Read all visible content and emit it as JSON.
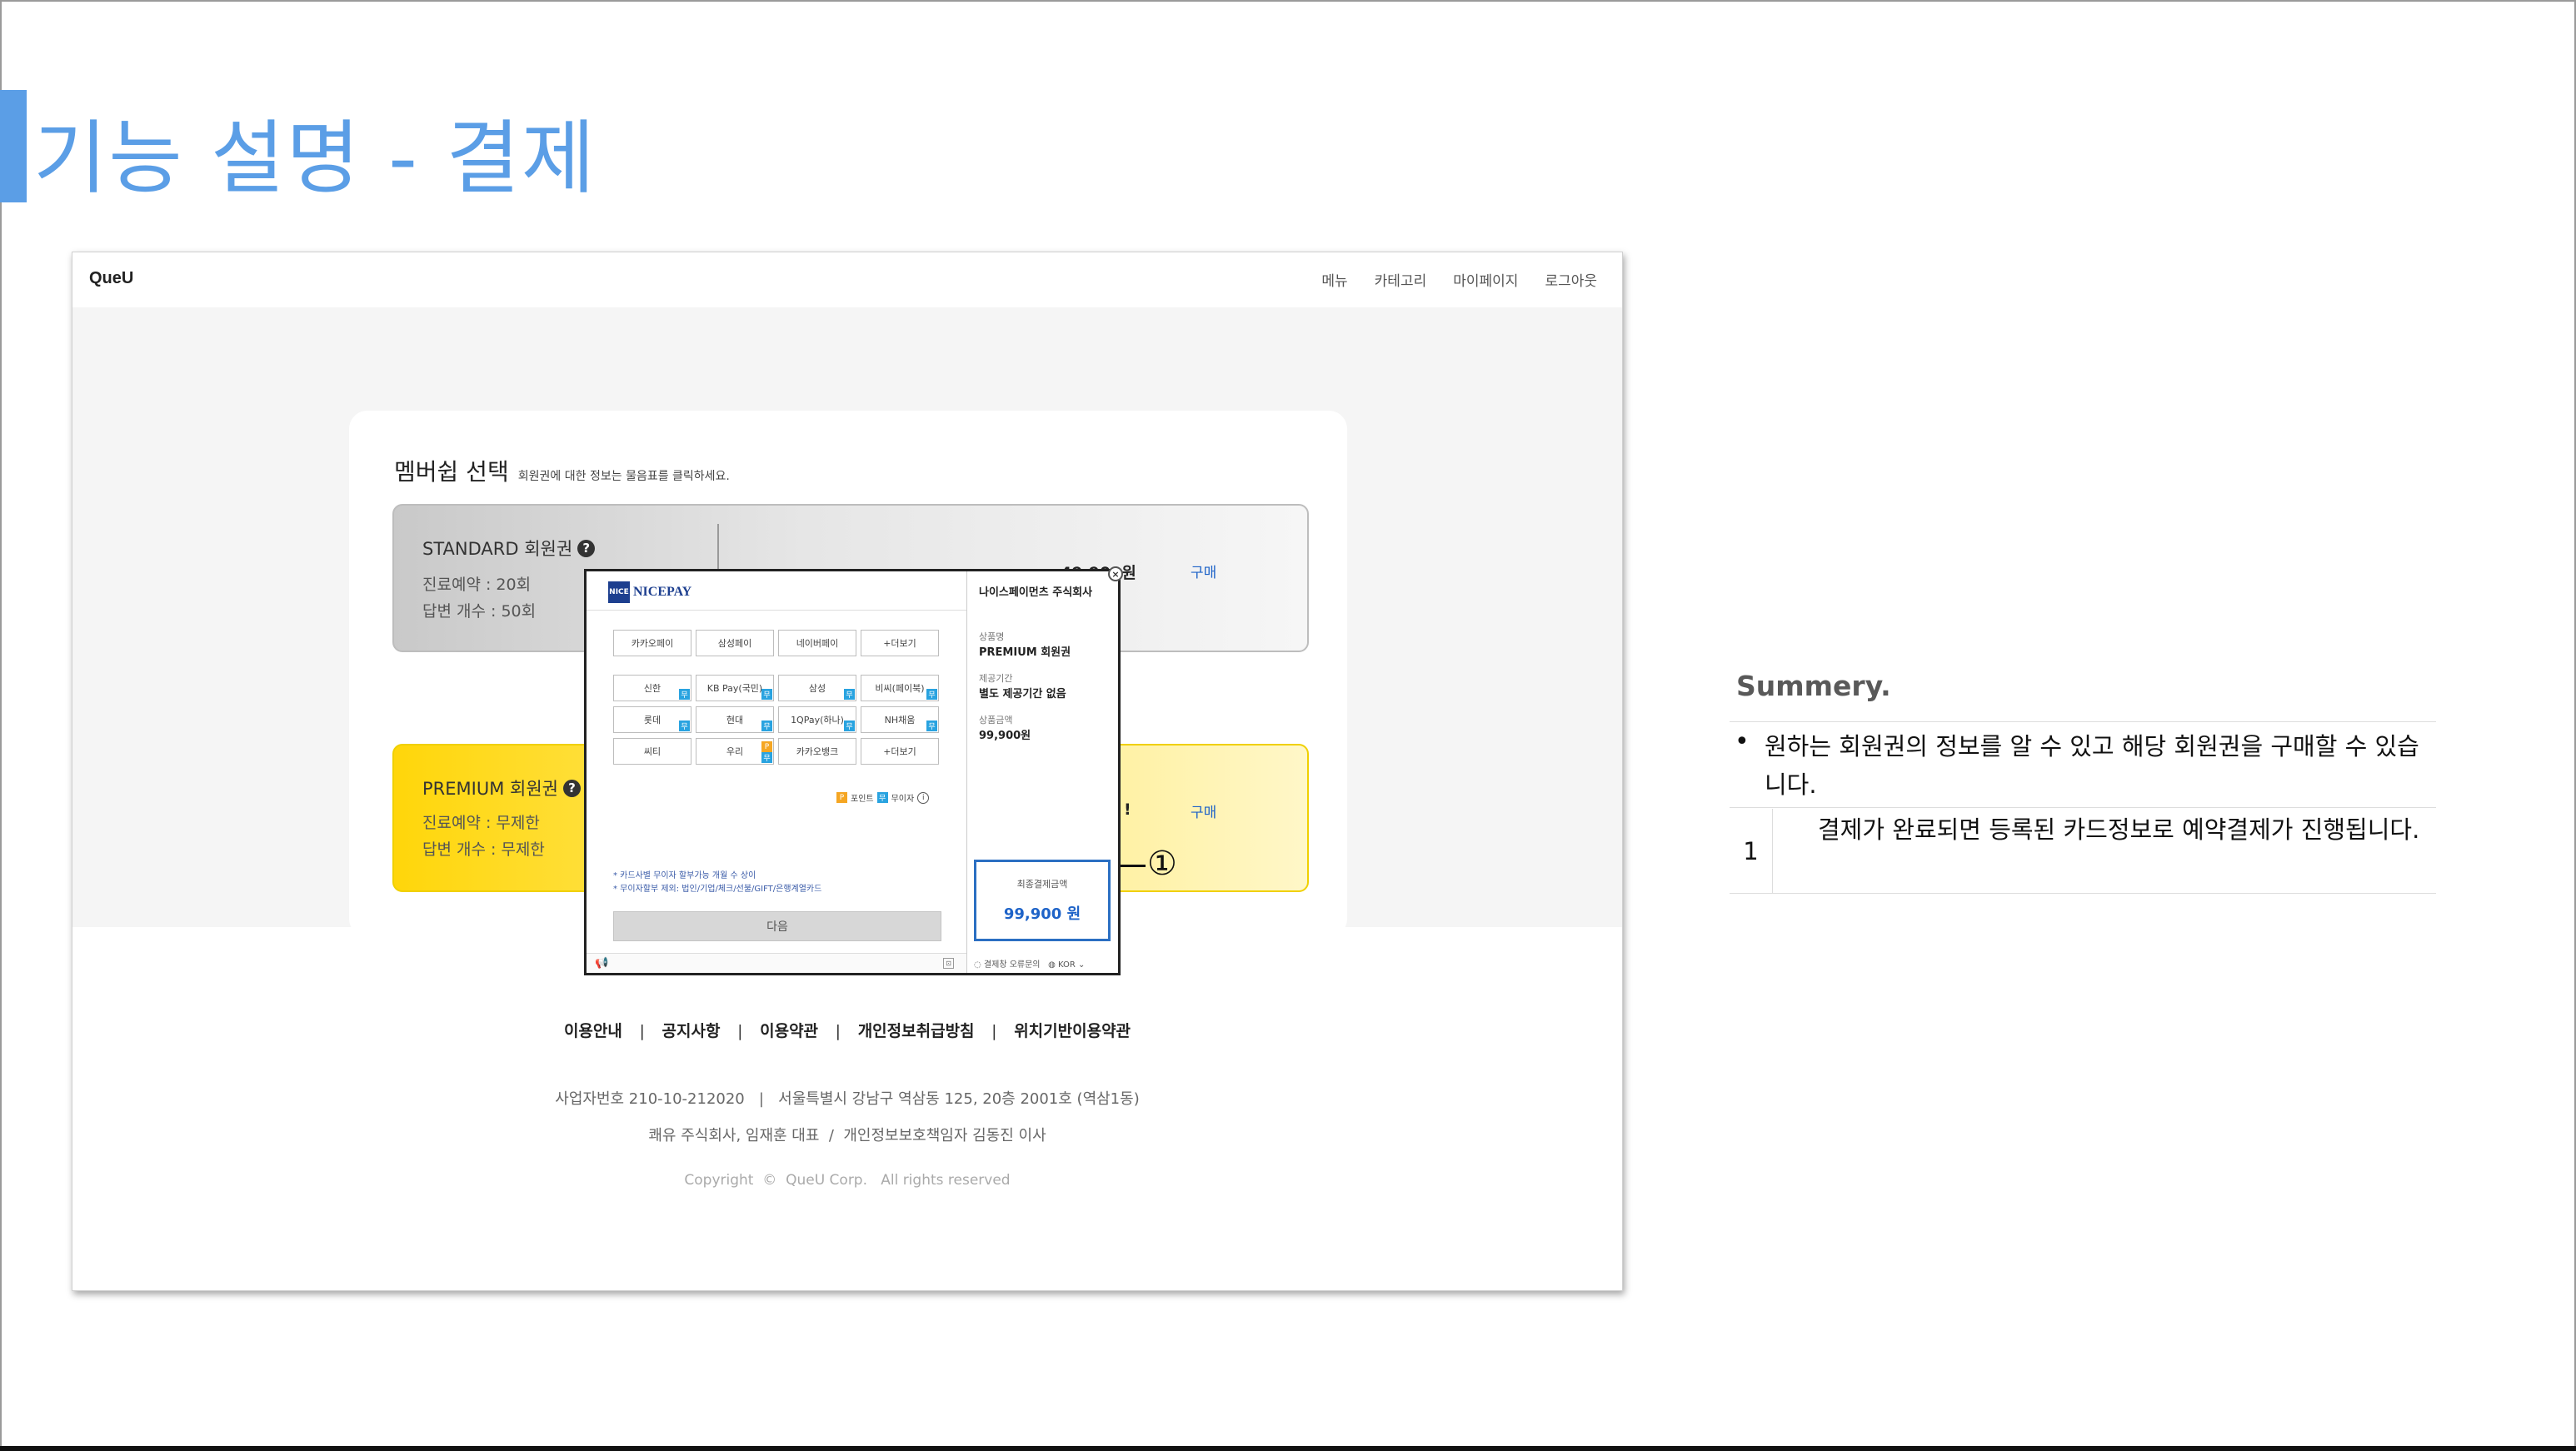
{
  "slide": {
    "title": "기능 설명 - 결제",
    "accent_color": "#5b9ee6"
  },
  "site": {
    "logo": "QueU",
    "nav": [
      "메뉴",
      "카테고리",
      "마이페이지",
      "로그아웃"
    ]
  },
  "membership": {
    "heading": "멤버쉽 선택",
    "subheading": "회원권에 대한 정보는 물음표를 클릭하세요.",
    "help_icon": "question-circle-icon",
    "plans": [
      {
        "name": "STANDARD 회원권",
        "lines": [
          "진료예약 : 20회",
          "답변 개수 : 50회"
        ],
        "price": "49,900원",
        "buy_label": "구매",
        "color": "#c9c9c9"
      },
      {
        "name": "PREMIUM 회원권",
        "lines": [
          "진료예약 : 무제한",
          "답변 개수 : 무제한"
        ],
        "price_fragment": "!",
        "buy_label": "구매",
        "color": "#ffd60a"
      }
    ]
  },
  "payment_popup": {
    "logo_text": "NICEPAY",
    "logo_mark": "NICE",
    "company": "나이스페이먼츠 주식회사",
    "easy_pay": [
      "카카오페이",
      "삼성페이",
      "네이버페이",
      "+더보기"
    ],
    "cards": [
      {
        "label": "신한",
        "badge": "blue"
      },
      {
        "label": "KB Pay(국민)",
        "badge": "blue"
      },
      {
        "label": "삼성",
        "badge": "blue"
      },
      {
        "label": "비씨(페이북)",
        "badge": "blue"
      },
      {
        "label": "롯데",
        "badge": "blue"
      },
      {
        "label": "현대",
        "badge": "blue"
      },
      {
        "label": "1QPay(하나)",
        "badge": "blue"
      },
      {
        "label": "NH채움",
        "badge": "blue"
      },
      {
        "label": "씨티",
        "badge": ""
      },
      {
        "label": "우리",
        "badge": "both"
      },
      {
        "label": "카카오뱅크",
        "badge": ""
      },
      {
        "label": "+더보기",
        "badge": ""
      }
    ],
    "legend": {
      "point_label": "포인트",
      "interest_free_label": "무이자",
      "point_badge": "P",
      "interest_free_badge": "무"
    },
    "notes": [
      "* 카드사별 무이자 할부가능 개월 수 상이",
      "* 무이자할부 제외: 법인/기업/체크/선불/GIFT/은행계열카드"
    ],
    "next_label": "다음",
    "product_name_label": "상품명",
    "product_name": "PREMIUM 회원권",
    "period_label": "제공기간",
    "period": "별도 제공기간 없음",
    "amount_label": "상품금액",
    "amount": "99,900원",
    "total_label": "최종결제금액",
    "total": "99,900 원",
    "footer_help": "결제창 오류문의",
    "language": "KOR",
    "close_icon": "close-icon",
    "megaphone_icon": "megaphone-icon",
    "brand_color": "#1d3f8f",
    "total_border_color": "#2b6fc2"
  },
  "callout": {
    "number": "①"
  },
  "footer": {
    "links": [
      "이용안내",
      "공지사항",
      "이용약관",
      "개인정보취급방침",
      "위치기반이용약관"
    ],
    "separator": "|",
    "business_info": "사업자번호 210-10-212020   |   서울특별시 강남구 역삼동 125, 20층 2001호 (역삼1동)",
    "company_info": "쾌유 주식회사, 임재훈 대표  /  개인정보보호책임자 김동진 이사",
    "copyright": "Copyright  ©  QueU Corp.   All rights reserved"
  },
  "summary": {
    "title": "Summery.",
    "bullet_symbol": "•",
    "bullet": "원하는 회원권의 정보를 알 수 있고 해당 회원권을 구매할 수 있습니다.",
    "step_number": "1",
    "step": "결제가 완료되면 등록된 카드정보로 예약결제가 진행됩니다."
  }
}
